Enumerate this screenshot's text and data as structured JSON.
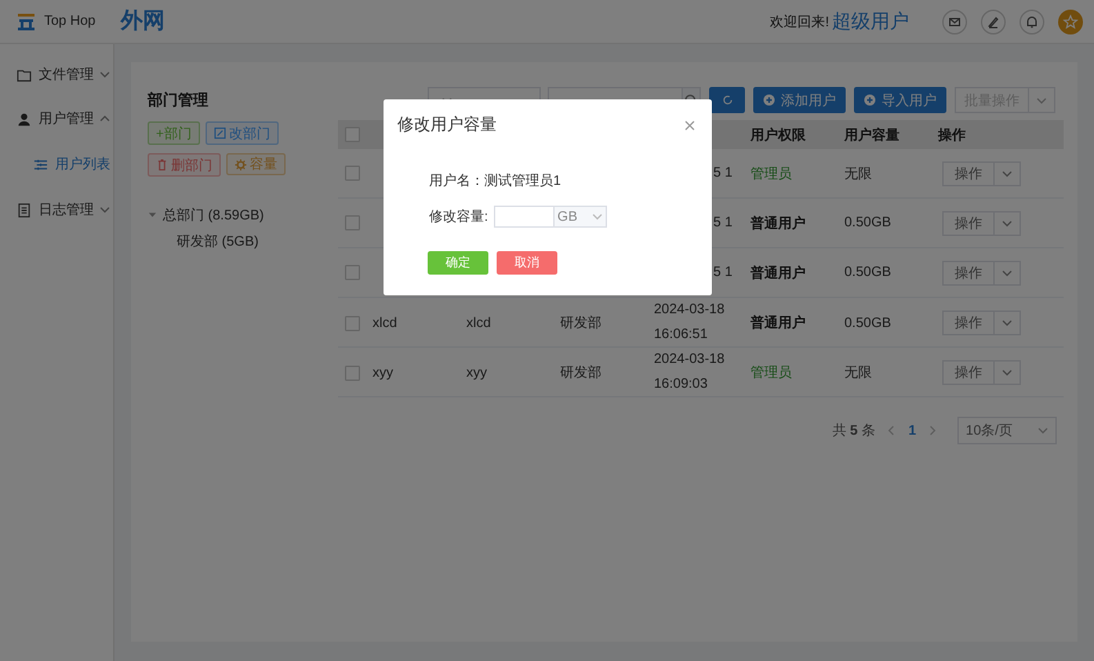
{
  "header": {
    "logo_text": "Top Hop",
    "site": "外网",
    "welcome": "欢迎回来!",
    "user": "超级用户"
  },
  "sidebar": {
    "items": [
      {
        "label": "文件管理",
        "expanded": false
      },
      {
        "label": "用户管理",
        "expanded": true,
        "children": [
          {
            "label": "用户列表",
            "selected": true
          }
        ]
      },
      {
        "label": "日志管理",
        "expanded": false
      }
    ]
  },
  "departments": {
    "title": "部门管理",
    "buttons": [
      {
        "label": "+部门",
        "kind": "add"
      },
      {
        "label": "改部门",
        "kind": "edit"
      },
      {
        "label": "删部门",
        "kind": "delete"
      },
      {
        "label": "容量",
        "kind": "capacity"
      }
    ],
    "tree": [
      {
        "label": "总部门 (8.59GB)",
        "expanded": true,
        "children": [
          {
            "label": "研发部 (5GB)"
          }
        ]
      }
    ]
  },
  "toolbar": {
    "buttons": [
      {
        "label": "添加用户"
      },
      {
        "label": "导入用户"
      }
    ],
    "batch": "批量操作"
  },
  "table": {
    "select_all": false,
    "columns": {
      "permission": "用户权限",
      "capacity": "用户容量",
      "actions": "操作"
    },
    "rows": [
      {
        "checked": false,
        "time": "5 1",
        "permission": "管理员",
        "kind": "admin",
        "capacity": "无限",
        "action": "操作"
      },
      {
        "checked": false,
        "time": "5 1",
        "permission": "普通用户",
        "kind": "user",
        "capacity": "0.50GB",
        "action": "操作"
      },
      {
        "checked": false,
        "time": "5 1",
        "permission": "普通用户",
        "kind": "user",
        "capacity": "0.50GB",
        "action": "操作"
      },
      {
        "checked": false,
        "name": "xlcd",
        "column_2": "xlcd",
        "department": "研发部",
        "time": "2024-03-18 16:06:51",
        "permission": "普通用户",
        "kind": "user",
        "capacity": "0.50GB",
        "action": "操作"
      },
      {
        "checked": false,
        "name": "xyy",
        "column_2": "xyy",
        "department": "研发部",
        "time": "2024-03-18 16:09:03",
        "permission": "管理员",
        "kind": "admin",
        "capacity": "无限",
        "action": "操作"
      }
    ]
  },
  "pagination": {
    "total": "共 **5** 条",
    "page": "1",
    "page_size": "10条/页"
  },
  "modal": {
    "title": "修改用户容量",
    "username": "用户名：测试管理员1",
    "capacity_label": "修改容量:",
    "unit": "GB",
    "ok": "确定",
    "cancel": "取消"
  }
}
